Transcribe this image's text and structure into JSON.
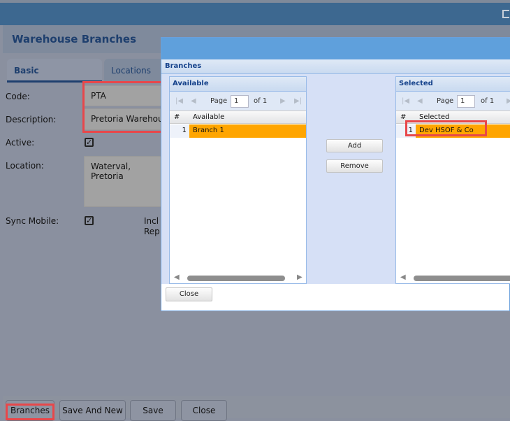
{
  "window": {
    "title": "Warehouse Branches",
    "maximize_icon": "maximize-icon"
  },
  "tabs": [
    {
      "label": "Basic",
      "active": true
    },
    {
      "label": "Locations",
      "active": false
    }
  ],
  "form": {
    "code_label": "Code:",
    "code_value": "PTA",
    "description_label": "Description:",
    "description_value": "Pretoria Warehouse",
    "active_label": "Active:",
    "active_checked": true,
    "location_label": "Location:",
    "location_value": "Waterval, Pretoria",
    "sync_label": "Sync Mobile:",
    "sync_checked": true,
    "incl_label_1": "Incl I",
    "incl_label_2": "Rep:"
  },
  "footer": {
    "branches": "Branches",
    "save_and_new": "Save And New",
    "save": "Save",
    "close": "Close"
  },
  "dialog": {
    "section_title": "Branches",
    "available": {
      "title": "Available",
      "page_label": "Page",
      "page": "1",
      "of": "of 1",
      "col_num": "#",
      "col_name": "Available",
      "rows": [
        {
          "num": "1",
          "name": "Branch 1"
        }
      ]
    },
    "selected": {
      "title": "Selected",
      "page_label": "Page",
      "page": "1",
      "of": "of 1",
      "col_num": "#",
      "col_name": "Selected",
      "rows": [
        {
          "num": "1",
          "name": "Dev HSOF & Co"
        }
      ]
    },
    "add": "Add",
    "remove": "Remove",
    "close": "Close"
  },
  "colors": {
    "highlight": "#ffa500",
    "annotation": "#e8474a",
    "header": "#5fa0dc"
  }
}
